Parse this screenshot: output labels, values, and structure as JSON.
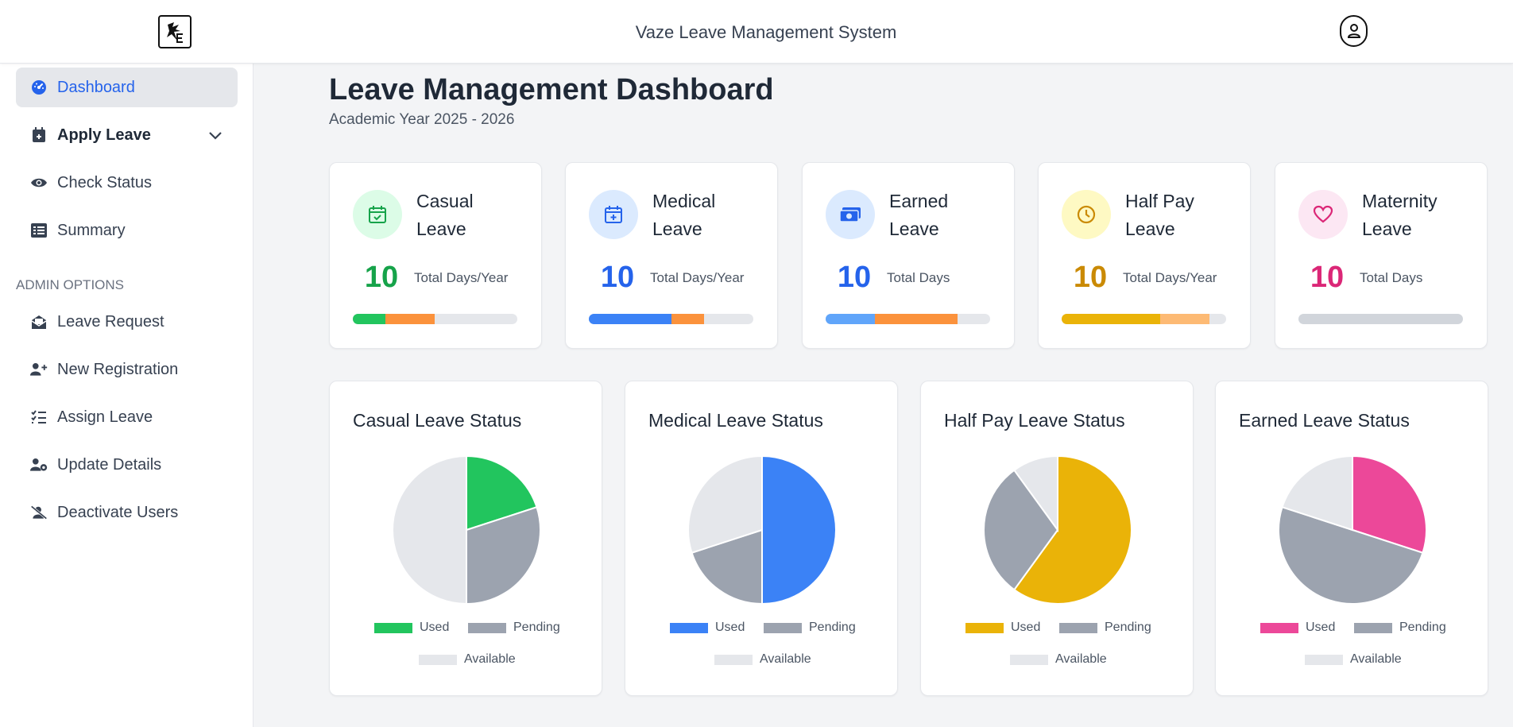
{
  "header": {
    "title": "Vaze Leave Management System",
    "logo_icon": "college-logo-icon",
    "profile_icon": "user-icon"
  },
  "sidebar": {
    "items": [
      {
        "label": "Dashboard",
        "icon": "gauge-icon",
        "active": true
      },
      {
        "label": "Apply Leave",
        "icon": "calendar-plus-icon",
        "expandable": true
      },
      {
        "label": "Check Status",
        "icon": "eye-icon"
      },
      {
        "label": "Summary",
        "icon": "list-icon"
      }
    ],
    "admin_label": "ADMIN OPTIONS",
    "admin_items": [
      {
        "label": "Leave Request",
        "icon": "envelope-open-icon"
      },
      {
        "label": "New Registration",
        "icon": "user-plus-icon"
      },
      {
        "label": "Assign Leave",
        "icon": "checklist-icon"
      },
      {
        "label": "Update Details",
        "icon": "user-gear-icon"
      },
      {
        "label": "Deactivate Users",
        "icon": "user-slash-icon"
      }
    ]
  },
  "main": {
    "title": "Leave Management Dashboard",
    "subtitle": "Academic Year 2025 - 2026"
  },
  "leave_cards": [
    {
      "title_1": "Casual",
      "title_2": "Leave",
      "total": "10",
      "unit": "Total Days/Year",
      "color": "#16a34a",
      "icon": "calendar-check-icon",
      "icon_bg": "#dcfce7",
      "used_fraction": 0.2,
      "pending_fraction": 0.3,
      "used_color": "#22c55e",
      "pending_color": "#fb923c"
    },
    {
      "title_1": "Medical",
      "title_2": "Leave",
      "total": "10",
      "unit": "Total Days/Year",
      "color": "#2563eb",
      "icon": "calendar-plus-icon",
      "icon_bg": "#dbeafe",
      "used_fraction": 0.5,
      "pending_fraction": 0.2,
      "used_color": "#3b82f6",
      "pending_color": "#fb923c"
    },
    {
      "title_1": "Earned",
      "title_2": "Leave",
      "total": "10",
      "unit": "Total Days",
      "color": "#2563eb",
      "icon": "money-icon",
      "icon_bg": "#dbeafe",
      "used_fraction": 0.3,
      "pending_fraction": 0.5,
      "used_color": "#60a5fa",
      "pending_color": "#fb923c"
    },
    {
      "title_1": "Half Pay",
      "title_2": "Leave",
      "total": "10",
      "unit": "Total Days/Year",
      "color": "#ca8a04",
      "icon": "clock-icon",
      "icon_bg": "#fef9c3",
      "used_fraction": 0.6,
      "pending_fraction": 0.3,
      "used_color": "#eab308",
      "pending_color": "#fdba74"
    },
    {
      "title_1": "Maternity",
      "title_2": "Leave",
      "total": "10",
      "unit": "Total Days",
      "color": "#db2777",
      "icon": "heart-icon",
      "icon_bg": "#fce7f3",
      "used_fraction": 0,
      "pending_fraction": 0,
      "used_color": "#ec4899",
      "pending_color": "#fb923c"
    }
  ],
  "chart_data": [
    {
      "type": "pie",
      "title": "Casual Leave Status",
      "labels": [
        "Used",
        "Pending",
        "Available"
      ],
      "values": [
        2,
        3,
        5
      ],
      "colors": [
        "#22c55e",
        "#9ca3af",
        "#e5e7eb"
      ],
      "legend_position": "bottom"
    },
    {
      "type": "pie",
      "title": "Medical Leave Status",
      "labels": [
        "Used",
        "Pending",
        "Available"
      ],
      "values": [
        5,
        2,
        3
      ],
      "colors": [
        "#3b82f6",
        "#9ca3af",
        "#e5e7eb"
      ],
      "legend_position": "bottom"
    },
    {
      "type": "pie",
      "title": "Half Pay Leave Status",
      "labels": [
        "Used",
        "Pending",
        "Available"
      ],
      "values": [
        6,
        3,
        1
      ],
      "colors": [
        "#eab308",
        "#9ca3af",
        "#e5e7eb"
      ],
      "legend_position": "bottom"
    },
    {
      "type": "pie",
      "title": "Earned Leave Status",
      "labels": [
        "Used",
        "Pending",
        "Available"
      ],
      "values": [
        3,
        5,
        2
      ],
      "colors": [
        "#ec4899",
        "#9ca3af",
        "#e5e7eb"
      ],
      "legend_position": "bottom"
    }
  ]
}
